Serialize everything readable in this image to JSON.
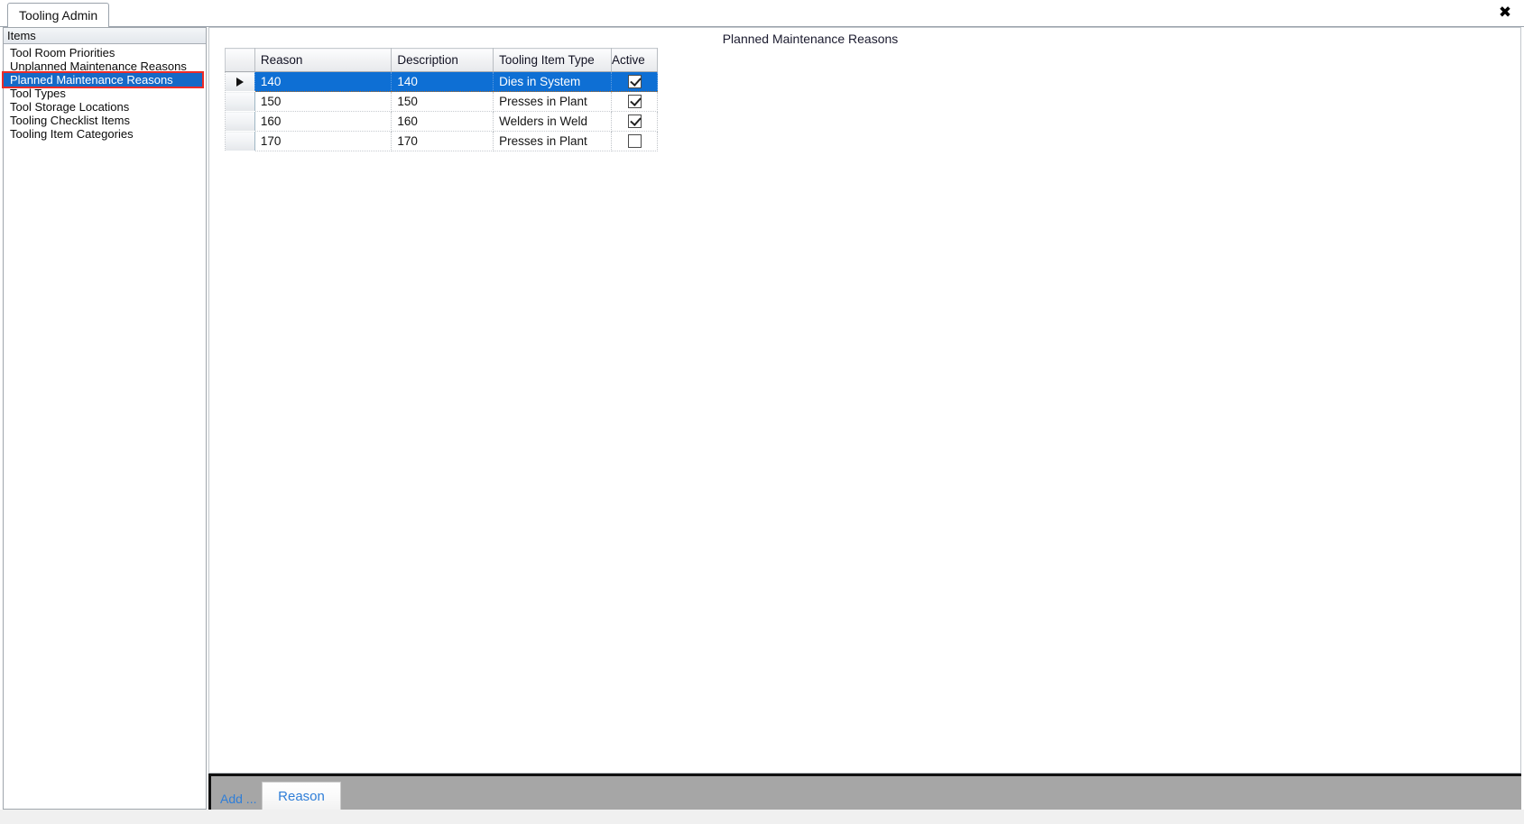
{
  "window": {
    "tab_label": "Tooling Admin",
    "close_icon": "close-icon",
    "close_glyph": "✖"
  },
  "sidebar": {
    "header": "Items",
    "items": [
      {
        "label": "Tool Room Priorities",
        "selected": false
      },
      {
        "label": "Unplanned Maintenance Reasons",
        "selected": false
      },
      {
        "label": "Planned Maintenance Reasons",
        "selected": true
      },
      {
        "label": "Tool Types",
        "selected": false
      },
      {
        "label": "Tool Storage Locations",
        "selected": false
      },
      {
        "label": "Tooling Checklist Items",
        "selected": false
      },
      {
        "label": "Tooling Item Categories",
        "selected": false
      }
    ]
  },
  "main": {
    "title": "Planned Maintenance Reasons",
    "grid": {
      "columns": [
        "Reason",
        "Description",
        "Tooling Item Type",
        "Active"
      ],
      "rows": [
        {
          "reason": "140",
          "description": "140",
          "type": "Dies in System",
          "active": true,
          "selected": true
        },
        {
          "reason": "150",
          "description": "150",
          "type": "Presses in Plant",
          "active": true,
          "selected": false
        },
        {
          "reason": "160",
          "description": "160",
          "type": "Welders in Weld",
          "active": true,
          "selected": false
        },
        {
          "reason": "170",
          "description": "170",
          "type": "Presses in Plant",
          "active": false,
          "selected": false
        }
      ]
    }
  },
  "toolbar": {
    "add_label": "Add ...",
    "reason_button": "Reason"
  },
  "colors": {
    "selection_blue": "#0e6fd4",
    "sidebar_selection_blue": "#1569c7",
    "annotation_red": "#ee2b26",
    "toolbar_gray": "#a6a6a6",
    "link_blue": "#2f7ed8"
  }
}
